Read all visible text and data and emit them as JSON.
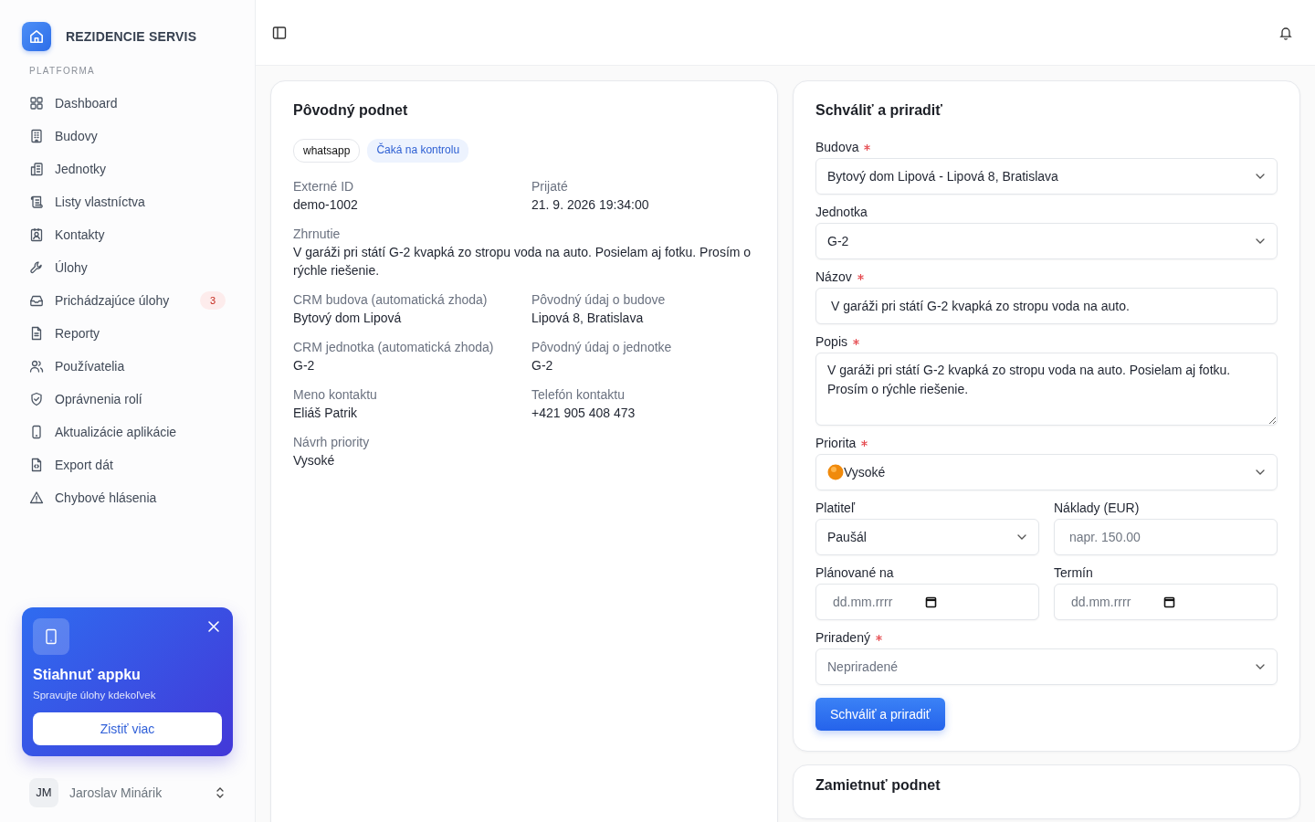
{
  "sidebar": {
    "brand": "REZIDENCIE SERVIS",
    "section": "PLATFORMA",
    "items": [
      {
        "label": "Dashboard"
      },
      {
        "label": "Budovy"
      },
      {
        "label": "Jednotky"
      },
      {
        "label": "Listy vlastníctva"
      },
      {
        "label": "Kontakty"
      },
      {
        "label": "Úlohy"
      },
      {
        "label": "Prichádzajúce úlohy",
        "badge": "3"
      },
      {
        "label": "Reporty"
      },
      {
        "label": "Používatelia"
      },
      {
        "label": "Oprávnenia rolí"
      },
      {
        "label": "Aktualizácie aplikácie"
      },
      {
        "label": "Export dát"
      },
      {
        "label": "Chybové hlásenia"
      }
    ],
    "promo": {
      "title": "Stiahnuť appku",
      "subtitle": "Spravujte úlohy kdekoľvek",
      "button": "Zistiť viac"
    },
    "user": {
      "initials": "JM",
      "name": "Jaroslav Minárik"
    }
  },
  "source_card": {
    "title": "Pôvodný podnet",
    "tags": [
      {
        "label": "whatsapp",
        "kind": "channel"
      },
      {
        "label": "Čaká na kontrolu",
        "kind": "status"
      }
    ],
    "fields": [
      {
        "label": "Externé ID",
        "value": "demo-1002"
      },
      {
        "label": "Prijaté",
        "value": "21. 9. 2026 19:34:00"
      },
      {
        "label": "Zhrnutie",
        "value": "V garáži pri státí G-2 kvapká zo stropu voda na auto. Posielam aj fotku. Prosím o rýchle riešenie.",
        "wide": true
      },
      {
        "label": "CRM budova (automatická zhoda)",
        "value": "Bytový dom Lipová"
      },
      {
        "label": "Pôvodný údaj o budove",
        "value": "Lipová 8, Bratislava"
      },
      {
        "label": "CRM jednotka (automatická zhoda)",
        "value": "G-2"
      },
      {
        "label": "Pôvodný údaj o jednotke",
        "value": "G-2"
      },
      {
        "label": "Meno kontaktu",
        "value": "Eliáš Patrik"
      },
      {
        "label": "Telefón kontaktu",
        "value": "+421 905 408 473"
      },
      {
        "label": "Návrh priority",
        "value": "Vysoké"
      }
    ]
  },
  "approve_form": {
    "title": "Schváliť a priradiť",
    "rows": [
      [
        {
          "label": "Budova",
          "required": true,
          "kind": "select",
          "value": "Bytový dom Lipová - Lipová 8, Bratislava"
        }
      ],
      [
        {
          "label": "Jednotka",
          "required": false,
          "kind": "select",
          "value": "G-2"
        }
      ],
      [
        {
          "label": "Názov",
          "required": true,
          "kind": "text",
          "value": "V garáži pri státí G-2 kvapká zo stropu voda na auto."
        }
      ],
      [
        {
          "label": "Popis",
          "required": true,
          "kind": "textarea",
          "value": "V garáži pri státí G-2 kvapká zo stropu voda na auto. Posielam aj fotku. Prosím o rýchle riešenie."
        }
      ],
      [
        {
          "label": "Priorita",
          "required": true,
          "kind": "priority",
          "value": "Vysoké"
        }
      ],
      [
        {
          "label": "Platiteľ",
          "required": false,
          "kind": "select",
          "value": "Paušál"
        },
        {
          "label": "Náklady (EUR)",
          "required": false,
          "kind": "text",
          "placeholder": "napr. 150.00"
        }
      ],
      [
        {
          "label": "Plánované na",
          "required": false,
          "kind": "date",
          "placeholder": "dd.mm.rrrr"
        },
        {
          "label": "Termín",
          "required": false,
          "kind": "date",
          "placeholder": "dd.mm.rrrr"
        }
      ],
      [
        {
          "label": "Priradený",
          "required": true,
          "kind": "select",
          "placeholder": "Nepriradené"
        }
      ]
    ],
    "submit": "Schváliť a priradiť"
  },
  "reject_card": {
    "title": "Zamietnuť podnet"
  }
}
